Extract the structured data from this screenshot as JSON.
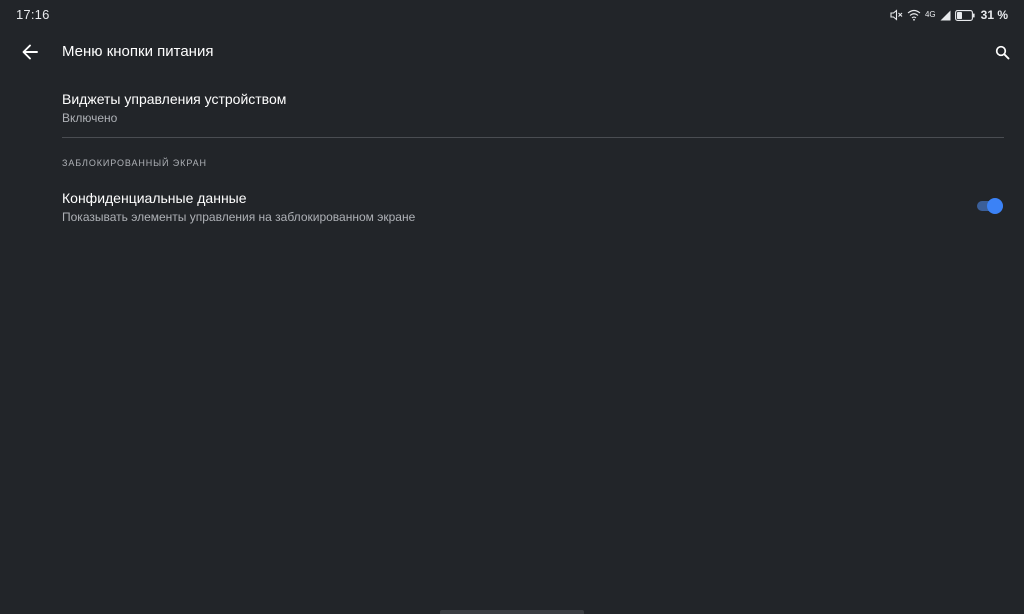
{
  "status_bar": {
    "time": "17:16",
    "network_type": "4G",
    "battery_percent": "31 %",
    "icons": [
      "muted-speaker-icon",
      "wifi-icon",
      "cellular-signal-icon",
      "battery-icon"
    ]
  },
  "app_bar": {
    "title": "Меню кнопки питания",
    "back_icon": "arrow-back-icon",
    "search_icon": "search-icon"
  },
  "preferences": {
    "device_controls": {
      "title": "Виджеты управления устройством",
      "summary": "Включено"
    },
    "lock_screen_category": "ЗАБЛОКИРОВАННЫЙ ЭКРАН",
    "private_data": {
      "title": "Конфиденциальные данные",
      "summary": "Показывать элементы управления на заблокированном экране",
      "enabled": true
    }
  },
  "colors": {
    "background": "#222529",
    "accent": "#3b82f6",
    "track_on": "#3b5f99",
    "secondary_text": "#aeb1b6",
    "divider": "#4a4d52"
  }
}
